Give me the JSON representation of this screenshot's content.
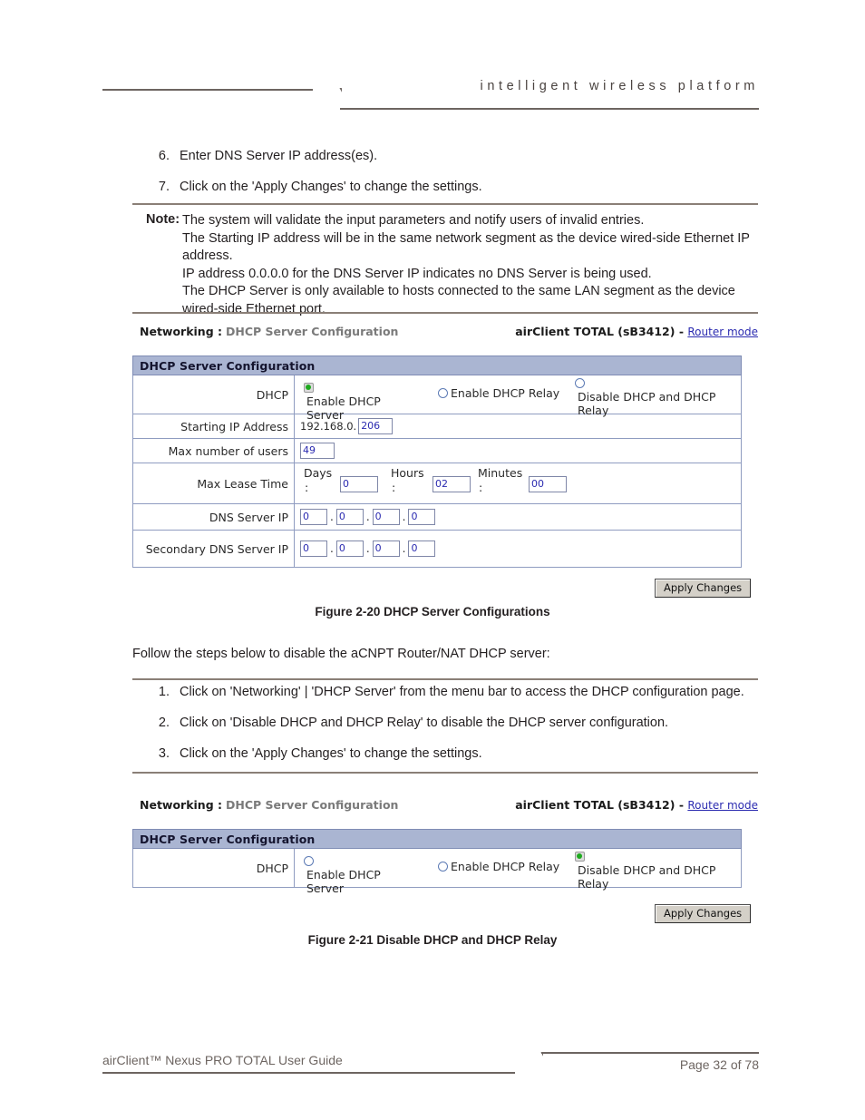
{
  "header": {
    "tagline": "intelligent wireless platform"
  },
  "steps_top": [
    {
      "num": "6.",
      "text": "Enter DNS Server IP address(es)."
    },
    {
      "num": "7.",
      "text": "Click on the 'Apply Changes' to change the settings."
    }
  ],
  "note": {
    "label": "Note:",
    "lines": [
      "The system will validate the input parameters and notify users of invalid entries.",
      "The Starting IP address will be in the same network segment as the device wired-side Ethernet IP address.",
      "IP address 0.0.0.0 for the DNS Server IP indicates no DNS Server is being used.",
      "The DHCP Server is only available to hosts connected to the same LAN segment as the device wired-side Ethernet port."
    ]
  },
  "figure_20": {
    "titlebar": {
      "menu": "Networking :",
      "page": "DHCP Server Configuration",
      "device": "airClient TOTAL (sB3412) -",
      "mode_link": "Router mode"
    },
    "table_header": "DHCP Server Configuration",
    "dhcp_row": {
      "label": "DHCP",
      "options": [
        {
          "label": "Enable DHCP Server",
          "selected": true
        },
        {
          "label": "Enable DHCP Relay",
          "selected": false
        },
        {
          "label": "Disable DHCP and DHCP Relay",
          "selected": false
        }
      ]
    },
    "starting_ip": {
      "label": "Starting IP Address",
      "prefix": "192.168.0.",
      "value": "206"
    },
    "max_users": {
      "label": "Max number of users",
      "value": "49"
    },
    "max_lease_time": {
      "label": "Max Lease Time",
      "units": [
        {
          "name": "Days",
          "colon": ":",
          "value": "0"
        },
        {
          "name": "Hours",
          "colon": ":",
          "value": "02"
        },
        {
          "name": "Minutes",
          "colon": ":",
          "value": "00"
        }
      ]
    },
    "dns_server_ip": {
      "label": "DNS Server IP",
      "octets": [
        "0",
        "0",
        "0",
        "0"
      ],
      "separator": "."
    },
    "secondary_dns_server_ip": {
      "label": "Secondary DNS Server IP",
      "octets": [
        "0",
        "0",
        "0",
        "0"
      ],
      "separator": "."
    },
    "apply_button": "Apply Changes",
    "caption": "Figure 2-20 DHCP Server Configurations"
  },
  "intro_text": "Follow the steps below to disable the aCNPT Router/NAT DHCP server:",
  "steps_bottom": [
    {
      "num": "1.",
      "text": "Click on 'Networking' | 'DHCP Server' from the menu bar to access the DHCP configuration page."
    },
    {
      "num": "2.",
      "text": "Click on 'Disable DHCP and DHCP Relay' to disable the DHCP server configuration."
    },
    {
      "num": "3.",
      "text": "Click on the 'Apply Changes' to change the settings."
    }
  ],
  "figure_21": {
    "titlebar": {
      "menu": "Networking :",
      "page": "DHCP Server Configuration",
      "device": "airClient TOTAL (sB3412) -",
      "mode_link": "Router mode"
    },
    "table_header": "DHCP Server Configuration",
    "dhcp_row": {
      "label": "DHCP",
      "options": [
        {
          "label": "Enable DHCP Server",
          "selected": false
        },
        {
          "label": "Enable DHCP Relay",
          "selected": false
        },
        {
          "label": "Disable DHCP and DHCP Relay",
          "selected": true
        }
      ]
    },
    "apply_button": "Apply Changes",
    "caption": "Figure 2-21 Disable DHCP and DHCP Relay"
  },
  "footer": {
    "left": "airClient™ Nexus PRO TOTAL User Guide",
    "right": "Page 32 of 78"
  },
  "colors": {
    "table_header_bg": "#aab5d2",
    "table_border": "#8f9cc0",
    "rule": "#8a7f77",
    "link": "#2b2bb0",
    "radio_on": "#1faa1f",
    "input_text": "#2a2ab0",
    "button_face": "#d4d0c8"
  }
}
